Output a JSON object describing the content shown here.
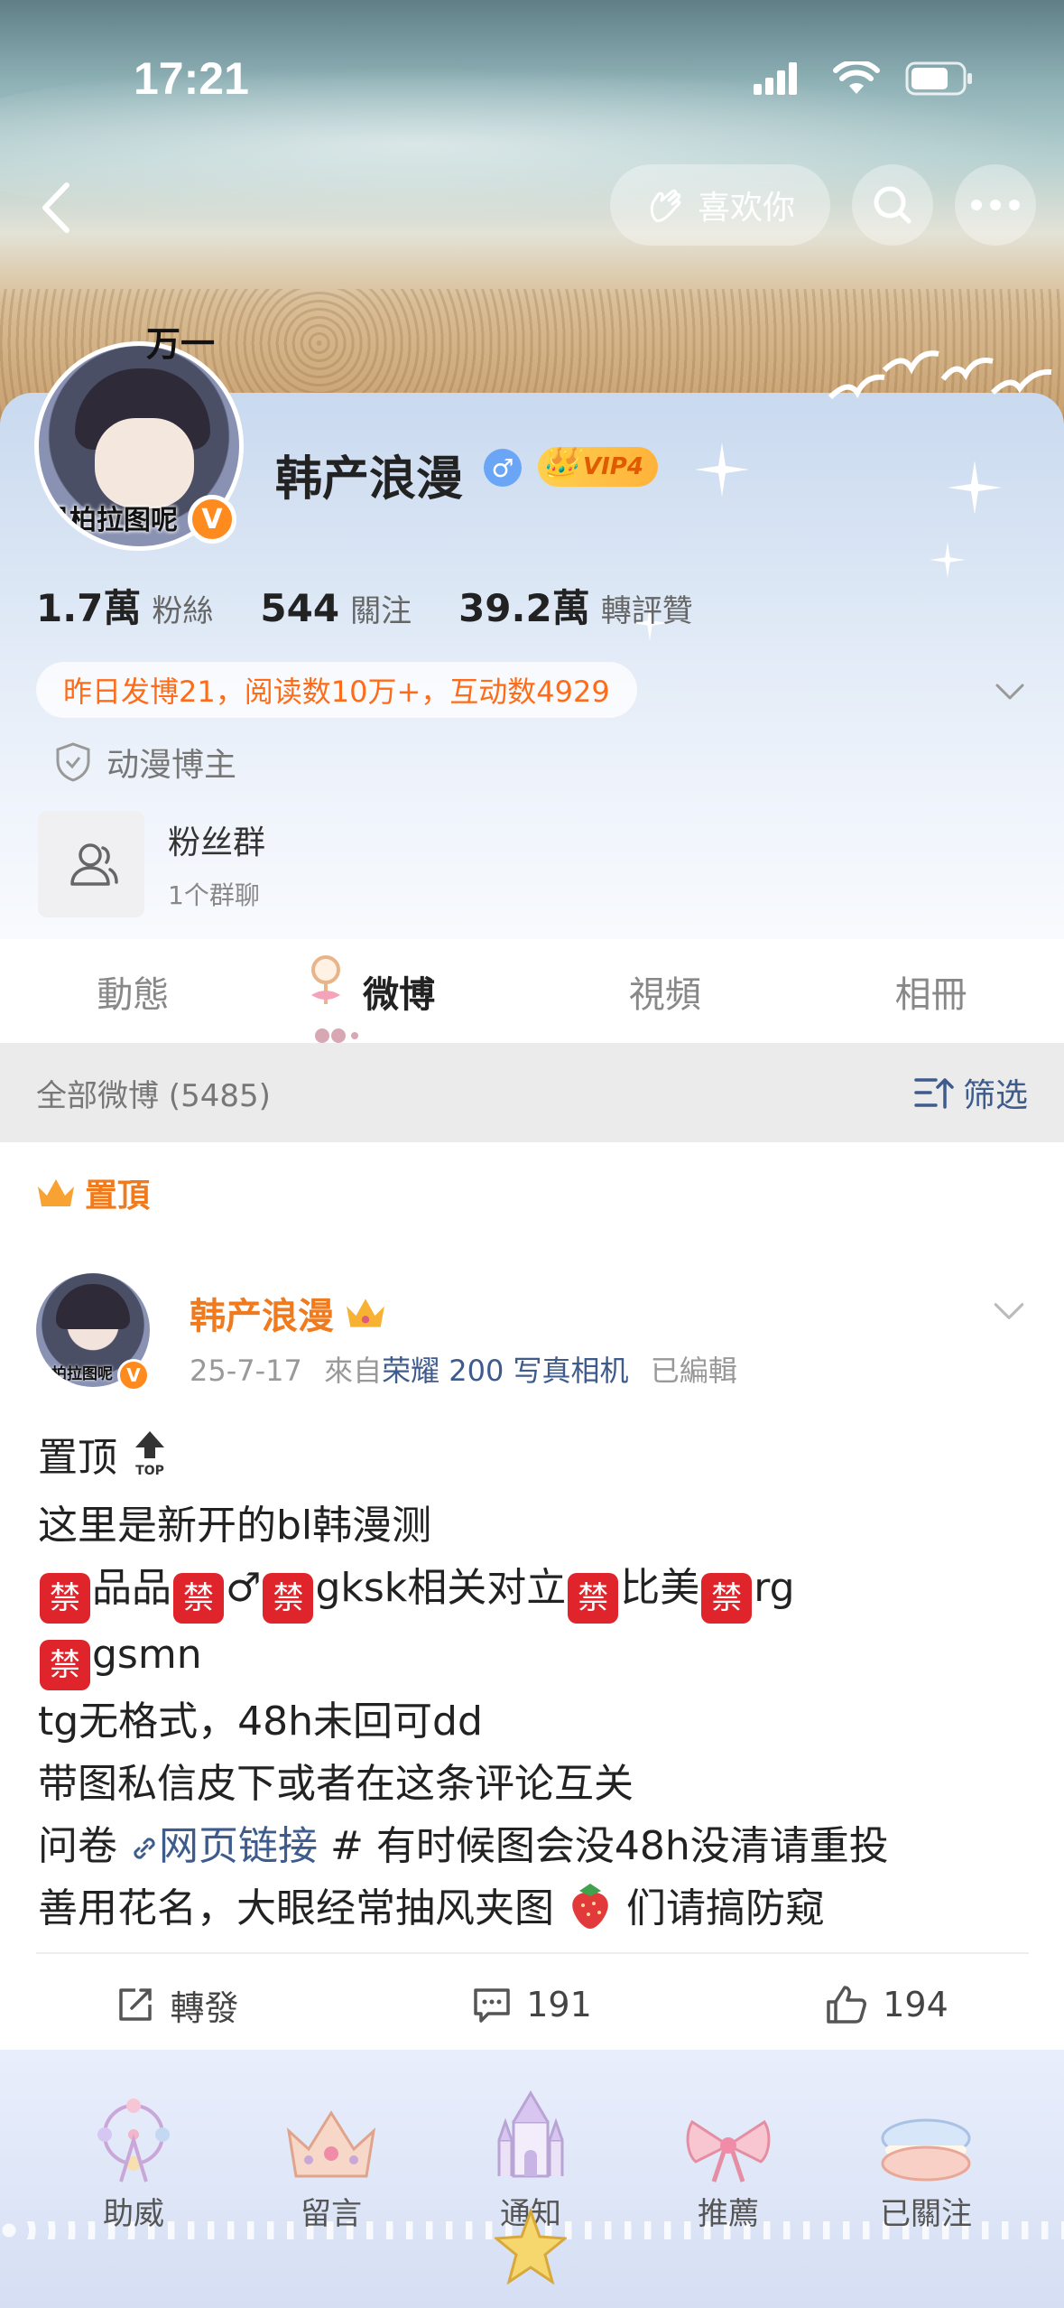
{
  "status_bar": {
    "time": "17:21"
  },
  "header": {
    "like_label": "喜欢你"
  },
  "profile": {
    "avatar_top_text": "万一",
    "avatar_caption": "是柏拉图呢",
    "verified_mark": "V",
    "name": "韩产浪漫",
    "gender_mark": "♂",
    "vip_label": "VIP4",
    "stats": [
      {
        "value": "1.7萬",
        "label": "粉絲"
      },
      {
        "value": "544",
        "label": "關注"
      },
      {
        "value": "39.2萬",
        "label": "轉評贊"
      }
    ],
    "daily_summary": "昨日发博21，阅读数10万+，互动数4929",
    "tag": "动漫博主",
    "fan_group": {
      "title": "粉丝群",
      "subtitle": "1个群聊"
    }
  },
  "tabs": [
    {
      "label": "動態"
    },
    {
      "label": "微博"
    },
    {
      "label": "視頻"
    },
    {
      "label": "相冊"
    }
  ],
  "filter": {
    "all_label": "全部微博 (5485)",
    "filter_label": "筛选"
  },
  "post": {
    "pinned_label": "置頂",
    "author": "韩产浪漫",
    "date": "25-7-17",
    "from_prefix": "來自",
    "source": "荣耀 200 写真相机",
    "edited": "已編輯",
    "lines": {
      "l1": "置顶",
      "l1_top": "TOP",
      "l2": "这里是新开的bl韩漫测",
      "l3a": "品品",
      "l3b": "♂",
      "l3c": "gksk相关对立",
      "l3d": "比美",
      "l3e": "rg",
      "l4": "gsmn",
      "l5": "tg无格式，48h未回可dd",
      "l6": "带图私信皮下或者在这条评论互关",
      "l7a": "问卷",
      "l7b": "网页链接",
      "l7c": "# 有时候图会没48h没清请重投",
      "l8a": "善用花名，大眼经常抽风夹图",
      "l8b": "们请搞防窥"
    },
    "ban_char": "禁",
    "actions": {
      "repost": "轉發",
      "comments": "191",
      "likes": "194"
    }
  },
  "bottom_nav": [
    {
      "label": "助威",
      "icon": "ferris-wheel-icon"
    },
    {
      "label": "留言",
      "icon": "crown-icon"
    },
    {
      "label": "通知",
      "icon": "castle-icon"
    },
    {
      "label": "推薦",
      "icon": "bow-icon"
    },
    {
      "label": "已關注",
      "icon": "macaron-icon"
    }
  ],
  "colors": {
    "accent_orange": "#f07b1f",
    "link_blue": "#3d5b8c",
    "ban_red": "#e0242c"
  }
}
